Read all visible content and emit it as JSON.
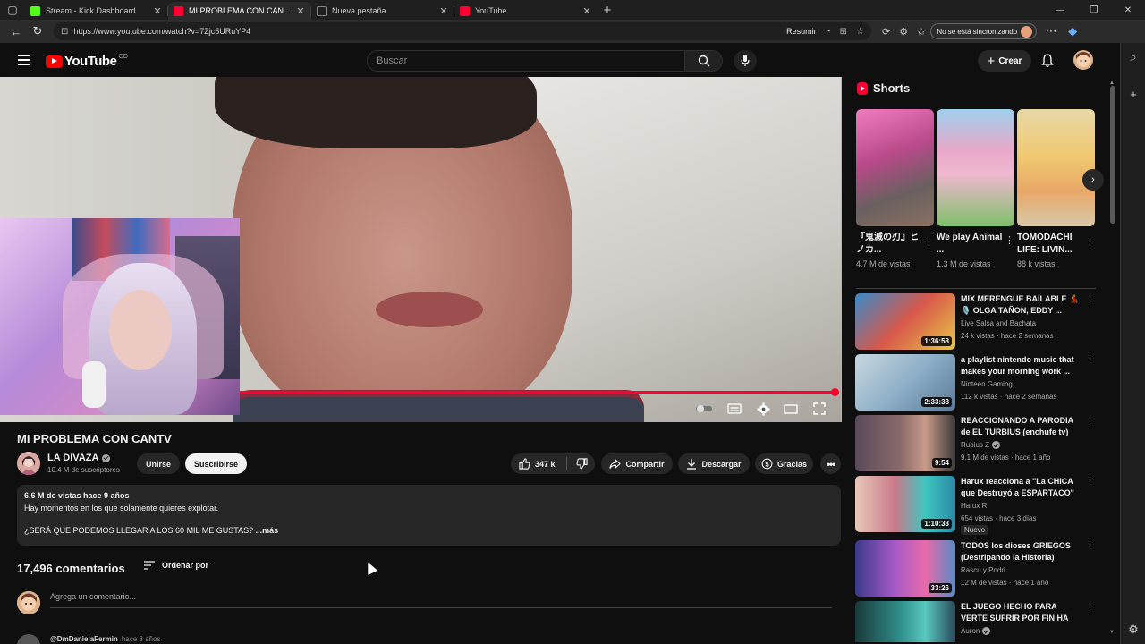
{
  "browser": {
    "tabs": [
      {
        "label": "Stream - Kick Dashboard",
        "color": "#53fc18",
        "active": false
      },
      {
        "label": "MI PROBLEMA CON CANTV - YouTube",
        "color": "#ff0033",
        "active": true
      },
      {
        "label": "Nueva pestaña",
        "color": "#888888",
        "active": false
      },
      {
        "label": "YouTube",
        "color": "#ff0033",
        "active": false
      }
    ],
    "url": "https://www.youtube.com/watch?v=7Zjc5URuYP4",
    "resumir_label": "Resumir",
    "sync_label": "No se está sincronizando"
  },
  "header": {
    "logo_text": "YouTube",
    "region_code": "CO",
    "search_placeholder": "Buscar",
    "create_label": "Crear"
  },
  "player": {
    "progress_fraction": 0.99
  },
  "video": {
    "title": "MI PROBLEMA CON CANTV",
    "channel_name": "LA DIVAZA",
    "subscribers": "10.4 M de suscriptores",
    "join_label": "Unirse",
    "subscribe_label": "Suscribirse",
    "likes": "347 k",
    "share_label": "Compartir",
    "download_label": "Descargar",
    "thanks_label": "Gracias"
  },
  "description": {
    "meta": "6.6 M de vistas  hace 9 años",
    "line1": "Hay momentos en los que solamente quieres explotar.",
    "line2": "¿SERÁ QUE PODEMOS LLEGAR A LOS 60 MIL ME GUSTAS?",
    "more_label": "...más"
  },
  "comments": {
    "count_label": "17,496 comentarios",
    "sort_label": "Ordenar por",
    "add_placeholder": "Agrega un comentario...",
    "first_author": "@DmDanielaFermin",
    "first_time": "hace 3 años"
  },
  "shorts": {
    "heading": "Shorts",
    "items": [
      {
        "title": "『鬼滅の刃』ヒノカ...",
        "views": "4.7 M de vistas",
        "color": "#c86aa0"
      },
      {
        "title": "We play Animal ...",
        "views": "1.3 M de vistas",
        "color": "#7fbf8a"
      },
      {
        "title": "TOMODACHI LIFE: LIVIN...",
        "views": "88 k vistas",
        "color": "#d8b85a"
      }
    ]
  },
  "recommended": [
    {
      "title": "MIX MERENGUE BAILABLE 💃 🎙️ OLGA TAÑON, EDDY ...",
      "channel": "Live Salsa and Bachata",
      "verified": false,
      "meta": "24 k vistas · hace 2 semanas",
      "duration": "1:36:58",
      "badge": "",
      "color": "#b24a4a"
    },
    {
      "title": "a playlist nintendo music that makes your morning work ...",
      "channel": "Ninteen Gaming",
      "verified": false,
      "meta": "112 k vistas · hace 2 semanas",
      "duration": "2:33:38",
      "badge": "",
      "color": "#9fb8c8"
    },
    {
      "title": "REACCIONANDO A PARODIA de EL TURBIUS (enchufe tv)",
      "channel": "Rubius Z",
      "verified": true,
      "meta": "9.1 M de vistas · hace 1 año",
      "duration": "9:54",
      "badge": "",
      "color": "#6a5a6a"
    },
    {
      "title": "Harux reacciona a \"La CHICA que Destruyó a ESPARTACO\"",
      "channel": "Harux R",
      "verified": false,
      "meta": "654 vistas · hace 3 días",
      "duration": "1:10:33",
      "badge": "Nuevo",
      "color": "#3fb6b0"
    },
    {
      "title": "TODOS los dioses GRIEGOS (Destripando la Historia)",
      "channel": "Rascu y Podri",
      "verified": false,
      "meta": "12 M de vistas · hace 1 año",
      "duration": "33:26",
      "badge": "",
      "color": "#8a5ab8"
    },
    {
      "title": "EL JUEGO HECHO PARA VERTE SUFRIR POR FIN HA SALIDO || ...",
      "channel": "Auron",
      "verified": true,
      "meta": "",
      "duration": "",
      "badge": "",
      "color": "#2f7f7a"
    }
  ]
}
